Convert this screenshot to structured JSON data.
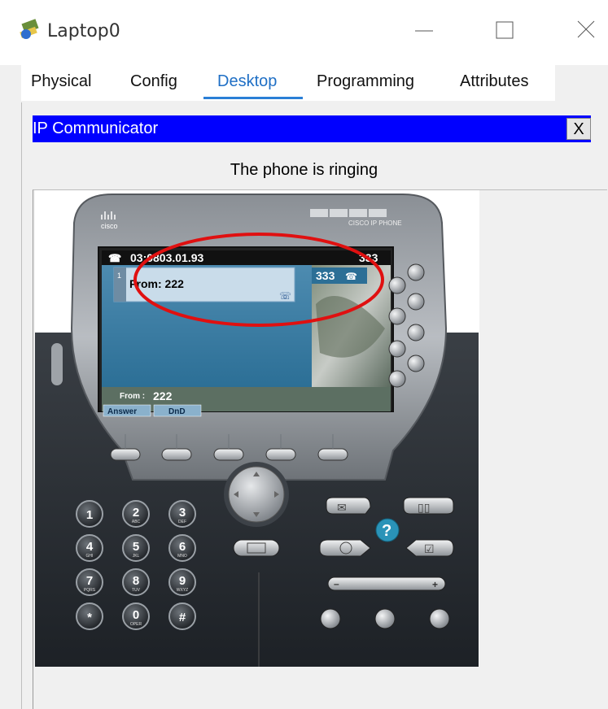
{
  "window": {
    "title": "Laptop0",
    "minimize_label": "—",
    "maximize_label": "☐",
    "close_label": "✕"
  },
  "tabs": [
    {
      "label": "Physical"
    },
    {
      "label": "Config"
    },
    {
      "label": "Desktop",
      "active": true
    },
    {
      "label": "Programming"
    },
    {
      "label": "Attributes"
    }
  ],
  "app": {
    "title": "IP Communicator",
    "close_label": "X",
    "status": "The phone is ringing"
  },
  "phone": {
    "brand": "cisco",
    "model": "CISCO IP PHONE",
    "screen": {
      "header_time": "03:0803.01.93",
      "header_ext": "333",
      "line_number": "1",
      "line_ext": "333",
      "call_label": "From: 222",
      "from_label": "From :",
      "from_value": "222",
      "softkeys": [
        "Answer",
        "DnD"
      ]
    },
    "keypad": [
      {
        "digit": "1",
        "letters": ""
      },
      {
        "digit": "2",
        "letters": "ABC"
      },
      {
        "digit": "3",
        "letters": "DEF"
      },
      {
        "digit": "4",
        "letters": "GHI"
      },
      {
        "digit": "5",
        "letters": "JKL"
      },
      {
        "digit": "6",
        "letters": "MNO"
      },
      {
        "digit": "7",
        "letters": "PQRS"
      },
      {
        "digit": "8",
        "letters": "TUV"
      },
      {
        "digit": "9",
        "letters": "WXYZ"
      },
      {
        "digit": "*",
        "letters": ""
      },
      {
        "digit": "0",
        "letters": "OPER"
      },
      {
        "digit": "#",
        "letters": ""
      }
    ],
    "volume": {
      "minus": "–",
      "plus": "+"
    },
    "help_label": "?"
  },
  "colors": {
    "accent_blue": "#0000ff",
    "tab_underline": "#2a7fd6",
    "annotation_red": "#e01010"
  }
}
